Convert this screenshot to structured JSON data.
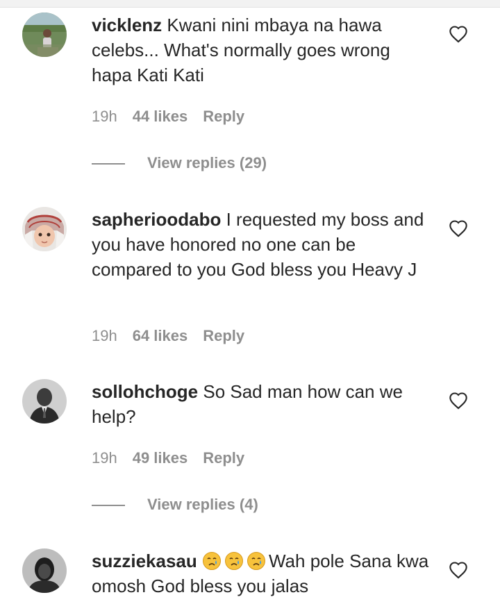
{
  "comments": [
    {
      "username": "vicklenz",
      "text": "Kwani nini mbaya na hawa celebs... What's normally goes wrong hapa Kati Kati",
      "time": "19h",
      "likes": "44 likes",
      "reply": "Reply",
      "view_replies": "View replies (29)"
    },
    {
      "username": "sapherioodabo",
      "text": "I requested my boss and you have honored no one can be compared to you God bless you Heavy J",
      "time": "19h",
      "likes": "64 likes",
      "reply": "Reply"
    },
    {
      "username": "sollohchoge",
      "text": "So Sad man how can we help?",
      "time": "19h",
      "likes": "49 likes",
      "reply": "Reply",
      "view_replies": "View replies (4)"
    },
    {
      "username": "suzziekasau",
      "emoji": [
        "crying-face",
        "crying-face",
        "crying-face"
      ],
      "text": "Wah pole Sana kwa omosh God bless you jalas"
    }
  ],
  "icons": {
    "like": "heart-outline-icon"
  },
  "colors": {
    "text": "#262626",
    "secondary": "#8e8e8e",
    "background": "#ffffff"
  }
}
